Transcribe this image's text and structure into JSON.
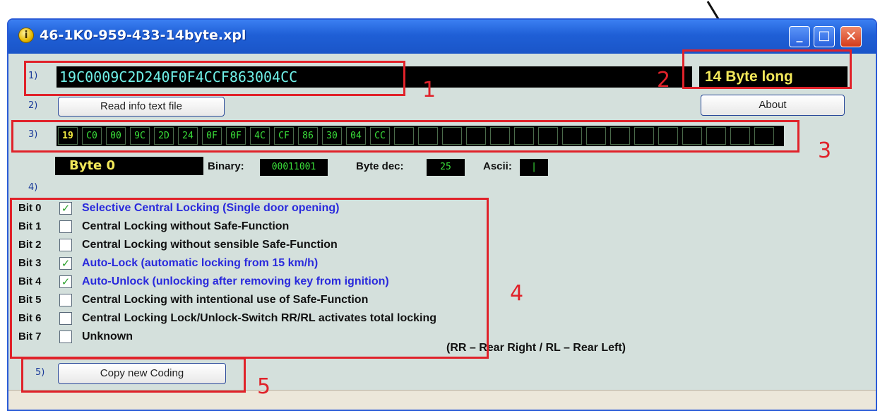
{
  "window": {
    "title": "46-1K0-959-433-14byte.xpl",
    "minimize_label": "_",
    "maximize_label": "□",
    "close_label": "✕"
  },
  "steps": {
    "s1": "1)",
    "s2": "2)",
    "s3": "3)",
    "s4": "4)",
    "s5": "5)"
  },
  "coding": {
    "value": "19C0009C2D240F0F4CCF863004CC",
    "length_label": "14 Byte long"
  },
  "buttons": {
    "read_info": "Read info text file",
    "about": "About",
    "copy_coding": "Copy new Coding"
  },
  "bytes": [
    "19",
    "C0",
    "00",
    "9C",
    "2D",
    "24",
    "0F",
    "0F",
    "4C",
    "CF",
    "86",
    "30",
    "04",
    "CC",
    "",
    "",
    "",
    "",
    "",
    "",
    "",
    "",
    "",
    "",
    "",
    "",
    "",
    "",
    "",
    ""
  ],
  "selected_byte": {
    "label": "Byte 0",
    "binary_label": "Binary:",
    "binary_value": "00011001",
    "dec_label": "Byte dec:",
    "dec_value": "25",
    "ascii_label": "Ascii:",
    "ascii_value": "|"
  },
  "bits": [
    {
      "label": "Bit 0",
      "checked": true,
      "text": "Selective Central Locking (Single door opening)"
    },
    {
      "label": "Bit 1",
      "checked": false,
      "text": "Central Locking without Safe-Function"
    },
    {
      "label": "Bit 2",
      "checked": false,
      "text": "Central Locking without sensible Safe-Function"
    },
    {
      "label": "Bit 3",
      "checked": true,
      "text": "Auto-Lock (automatic locking from 15 km/h)"
    },
    {
      "label": "Bit 4",
      "checked": true,
      "text": "Auto-Unlock (unlocking after removing key from ignition)"
    },
    {
      "label": "Bit 5",
      "checked": false,
      "text": "Central Locking with intentional use of Safe-Function"
    },
    {
      "label": "Bit 6",
      "checked": false,
      "text": "Central Locking Lock/Unlock-Switch RR/RL activates total locking"
    },
    {
      "label": "Bit 7",
      "checked": false,
      "text": "Unknown"
    }
  ],
  "note": "(RR – Rear Right / RL – Rear Left)",
  "annotations": {
    "n1": "1",
    "n2": "2",
    "n3": "3",
    "n4": "4",
    "n5": "5"
  },
  "colors": {
    "highlight_red": "#e0222a",
    "checked_blue": "#2a2adc",
    "hex_green": "#3ae13a",
    "hex_yellow": "#f4ec40"
  }
}
